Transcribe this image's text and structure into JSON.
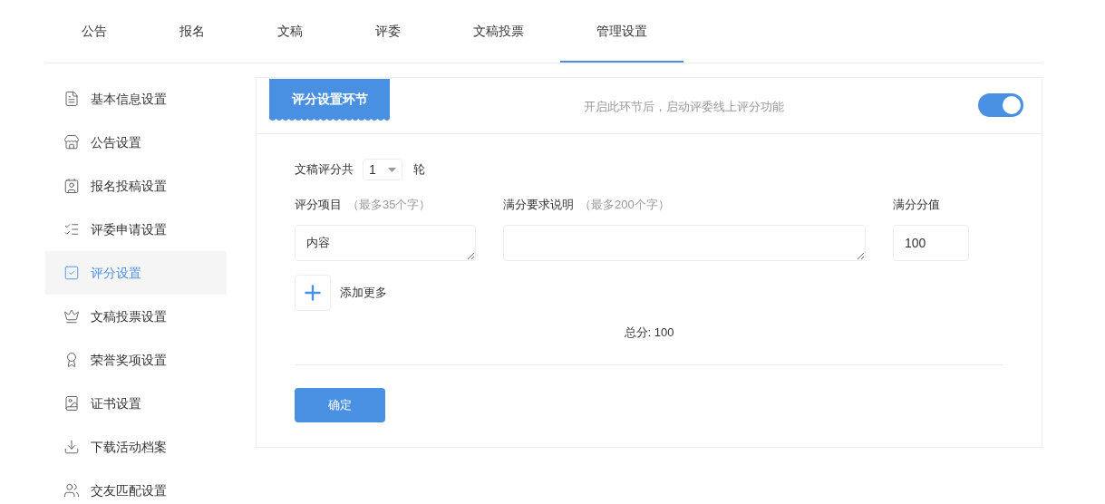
{
  "tabs": [
    {
      "label": "公告",
      "selected": false
    },
    {
      "label": "报名",
      "selected": false
    },
    {
      "label": "文稿",
      "selected": false
    },
    {
      "label": "评委",
      "selected": false
    },
    {
      "label": "文稿投票",
      "selected": false
    },
    {
      "label": "管理设置",
      "selected": true
    }
  ],
  "sidebar": {
    "items": [
      {
        "label": "基本信息设置",
        "selected": false
      },
      {
        "label": "公告设置",
        "selected": false
      },
      {
        "label": "报名投稿设置",
        "selected": false
      },
      {
        "label": "评委申请设置",
        "selected": false
      },
      {
        "label": "评分设置",
        "selected": true
      },
      {
        "label": "文稿投票设置",
        "selected": false
      },
      {
        "label": "荣誉奖项设置",
        "selected": false
      },
      {
        "label": "证书设置",
        "selected": false
      },
      {
        "label": "下载活动档案",
        "selected": false
      },
      {
        "label": "交友匹配设置",
        "selected": false
      }
    ]
  },
  "panel": {
    "section_label": "评分设置环节",
    "description": "开启此环节后，启动评委线上评分功能",
    "enabled": true,
    "rounds": {
      "label": "文稿评分共",
      "value": "1",
      "suffix": "轮"
    },
    "columns": [
      {
        "label": "评分项目",
        "hint": "（最多35个字）"
      },
      {
        "label": "满分要求说明",
        "hint": "（最多200个字）"
      },
      {
        "label": "满分分值"
      }
    ],
    "rows": [
      {
        "item": "内容",
        "score": "100"
      }
    ],
    "add_more": "添加更多",
    "total": "总分: 100",
    "confirm": "确定"
  }
}
